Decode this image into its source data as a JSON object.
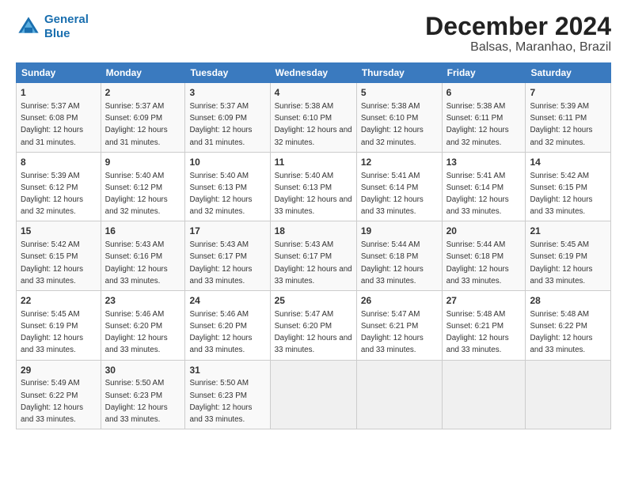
{
  "logo": {
    "line1": "General",
    "line2": "Blue"
  },
  "title": "December 2024",
  "location": "Balsas, Maranhao, Brazil",
  "days_of_week": [
    "Sunday",
    "Monday",
    "Tuesday",
    "Wednesday",
    "Thursday",
    "Friday",
    "Saturday"
  ],
  "weeks": [
    [
      {
        "day": "1",
        "sunrise": "5:37 AM",
        "sunset": "6:08 PM",
        "daylight": "12 hours and 31 minutes."
      },
      {
        "day": "2",
        "sunrise": "5:37 AM",
        "sunset": "6:09 PM",
        "daylight": "12 hours and 31 minutes."
      },
      {
        "day": "3",
        "sunrise": "5:37 AM",
        "sunset": "6:09 PM",
        "daylight": "12 hours and 31 minutes."
      },
      {
        "day": "4",
        "sunrise": "5:38 AM",
        "sunset": "6:10 PM",
        "daylight": "12 hours and 32 minutes."
      },
      {
        "day": "5",
        "sunrise": "5:38 AM",
        "sunset": "6:10 PM",
        "daylight": "12 hours and 32 minutes."
      },
      {
        "day": "6",
        "sunrise": "5:38 AM",
        "sunset": "6:11 PM",
        "daylight": "12 hours and 32 minutes."
      },
      {
        "day": "7",
        "sunrise": "5:39 AM",
        "sunset": "6:11 PM",
        "daylight": "12 hours and 32 minutes."
      }
    ],
    [
      {
        "day": "8",
        "sunrise": "5:39 AM",
        "sunset": "6:12 PM",
        "daylight": "12 hours and 32 minutes."
      },
      {
        "day": "9",
        "sunrise": "5:40 AM",
        "sunset": "6:12 PM",
        "daylight": "12 hours and 32 minutes."
      },
      {
        "day": "10",
        "sunrise": "5:40 AM",
        "sunset": "6:13 PM",
        "daylight": "12 hours and 32 minutes."
      },
      {
        "day": "11",
        "sunrise": "5:40 AM",
        "sunset": "6:13 PM",
        "daylight": "12 hours and 33 minutes."
      },
      {
        "day": "12",
        "sunrise": "5:41 AM",
        "sunset": "6:14 PM",
        "daylight": "12 hours and 33 minutes."
      },
      {
        "day": "13",
        "sunrise": "5:41 AM",
        "sunset": "6:14 PM",
        "daylight": "12 hours and 33 minutes."
      },
      {
        "day": "14",
        "sunrise": "5:42 AM",
        "sunset": "6:15 PM",
        "daylight": "12 hours and 33 minutes."
      }
    ],
    [
      {
        "day": "15",
        "sunrise": "5:42 AM",
        "sunset": "6:15 PM",
        "daylight": "12 hours and 33 minutes."
      },
      {
        "day": "16",
        "sunrise": "5:43 AM",
        "sunset": "6:16 PM",
        "daylight": "12 hours and 33 minutes."
      },
      {
        "day": "17",
        "sunrise": "5:43 AM",
        "sunset": "6:17 PM",
        "daylight": "12 hours and 33 minutes."
      },
      {
        "day": "18",
        "sunrise": "5:43 AM",
        "sunset": "6:17 PM",
        "daylight": "12 hours and 33 minutes."
      },
      {
        "day": "19",
        "sunrise": "5:44 AM",
        "sunset": "6:18 PM",
        "daylight": "12 hours and 33 minutes."
      },
      {
        "day": "20",
        "sunrise": "5:44 AM",
        "sunset": "6:18 PM",
        "daylight": "12 hours and 33 minutes."
      },
      {
        "day": "21",
        "sunrise": "5:45 AM",
        "sunset": "6:19 PM",
        "daylight": "12 hours and 33 minutes."
      }
    ],
    [
      {
        "day": "22",
        "sunrise": "5:45 AM",
        "sunset": "6:19 PM",
        "daylight": "12 hours and 33 minutes."
      },
      {
        "day": "23",
        "sunrise": "5:46 AM",
        "sunset": "6:20 PM",
        "daylight": "12 hours and 33 minutes."
      },
      {
        "day": "24",
        "sunrise": "5:46 AM",
        "sunset": "6:20 PM",
        "daylight": "12 hours and 33 minutes."
      },
      {
        "day": "25",
        "sunrise": "5:47 AM",
        "sunset": "6:20 PM",
        "daylight": "12 hours and 33 minutes."
      },
      {
        "day": "26",
        "sunrise": "5:47 AM",
        "sunset": "6:21 PM",
        "daylight": "12 hours and 33 minutes."
      },
      {
        "day": "27",
        "sunrise": "5:48 AM",
        "sunset": "6:21 PM",
        "daylight": "12 hours and 33 minutes."
      },
      {
        "day": "28",
        "sunrise": "5:48 AM",
        "sunset": "6:22 PM",
        "daylight": "12 hours and 33 minutes."
      }
    ],
    [
      {
        "day": "29",
        "sunrise": "5:49 AM",
        "sunset": "6:22 PM",
        "daylight": "12 hours and 33 minutes."
      },
      {
        "day": "30",
        "sunrise": "5:50 AM",
        "sunset": "6:23 PM",
        "daylight": "12 hours and 33 minutes."
      },
      {
        "day": "31",
        "sunrise": "5:50 AM",
        "sunset": "6:23 PM",
        "daylight": "12 hours and 33 minutes."
      },
      null,
      null,
      null,
      null
    ]
  ]
}
